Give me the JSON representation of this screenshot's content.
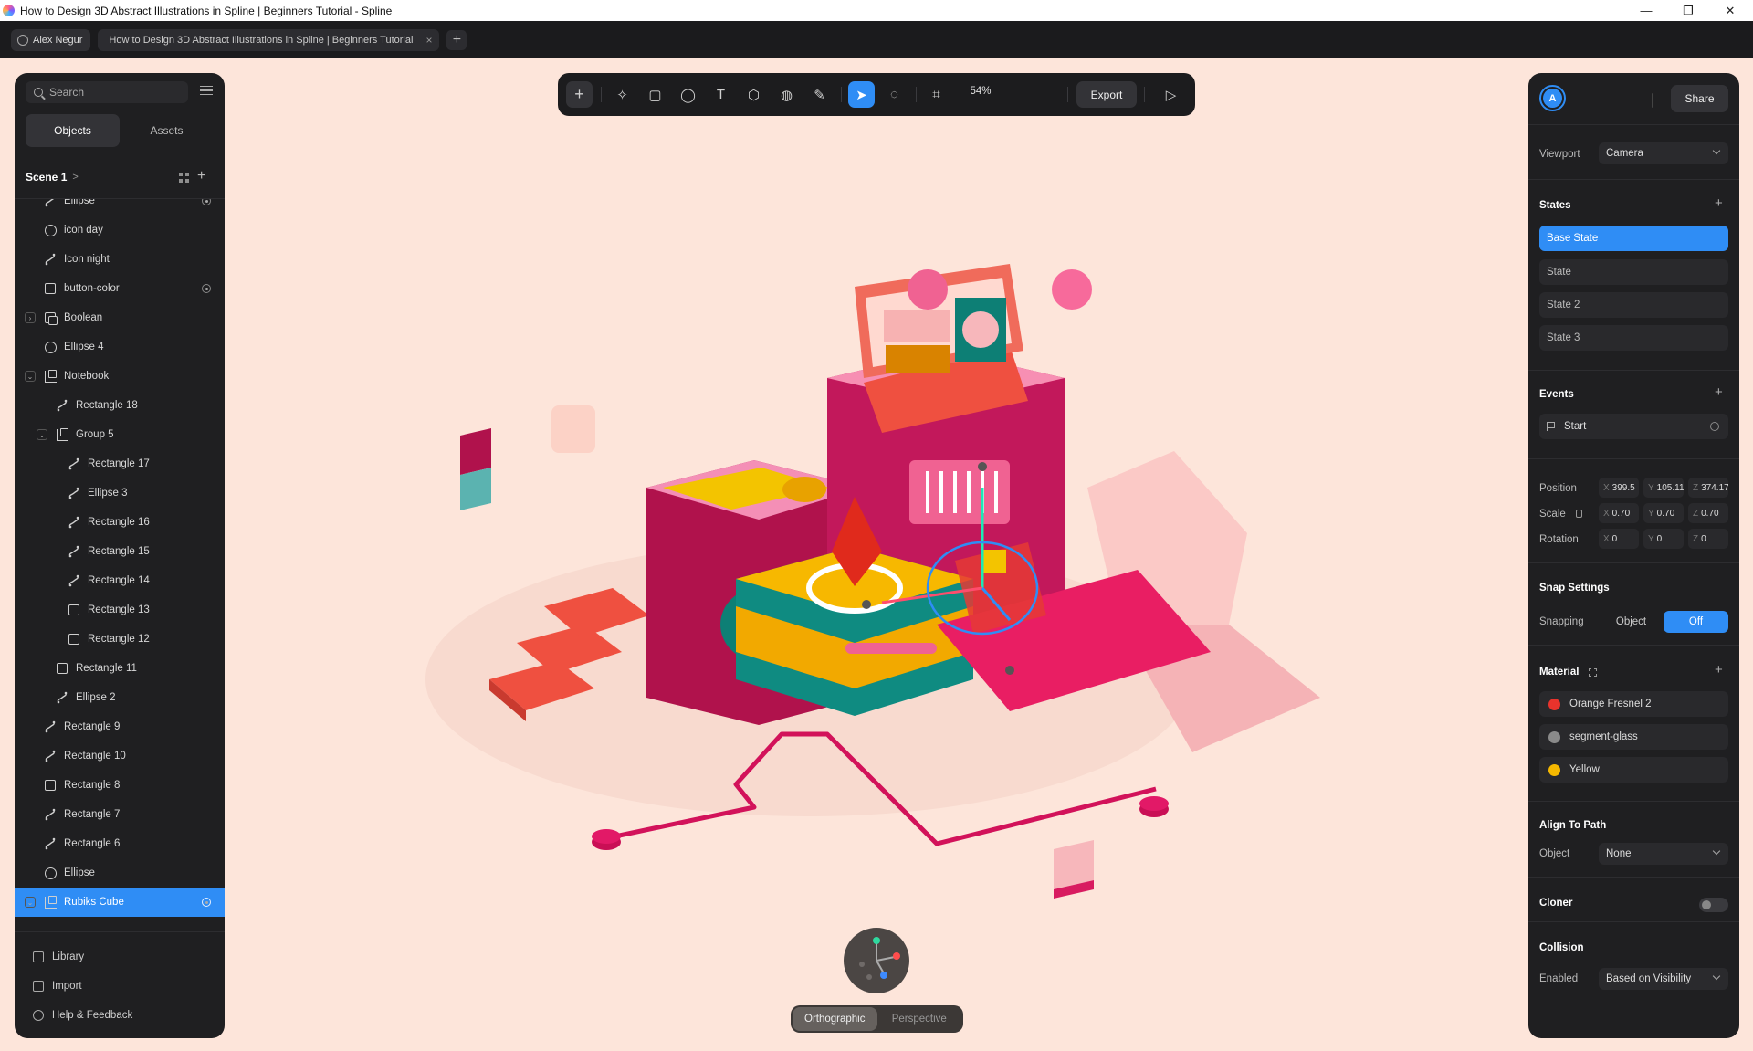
{
  "window": {
    "title": "How to Design 3D Abstract Illustrations in Spline | Beginners Tutorial - Spline",
    "minimize": "—",
    "maximize": "❐",
    "close": "✕"
  },
  "tabbar": {
    "user": "Alex Negur",
    "doc_tab": "How to Design 3D Abstract Illustrations in Spline | Beginners Tutorial",
    "close": "×",
    "add": "+"
  },
  "left_panel": {
    "search_placeholder": "Search",
    "tabs": [
      "Objects",
      "Assets"
    ],
    "scene_name": "Scene 1",
    "scene_chevron": ">",
    "add": "+",
    "tree": [
      {
        "label": "Ellipse",
        "icon": "path-icon",
        "depth": 1,
        "vis": true
      },
      {
        "label": "icon day",
        "icon": "circle-icon",
        "depth": 1,
        "vis": false
      },
      {
        "label": "Icon night",
        "icon": "path-icon",
        "depth": 1,
        "vis": false
      },
      {
        "label": "button-color",
        "icon": "square-icon",
        "depth": 1,
        "vis": true
      },
      {
        "label": "Boolean",
        "icon": "boolean-icon",
        "depth": 1,
        "vis": false,
        "caret": ">"
      },
      {
        "label": "Ellipse 4",
        "icon": "circle-icon",
        "depth": 1,
        "vis": false
      },
      {
        "label": "Notebook",
        "icon": "group-icon",
        "depth": 1,
        "vis": false,
        "caret": "v"
      },
      {
        "label": "Rectangle 18",
        "icon": "path-icon",
        "depth": 2,
        "vis": false
      },
      {
        "label": "Group 5",
        "icon": "group-icon",
        "depth": 2,
        "vis": false,
        "caret": "v"
      },
      {
        "label": "Rectangle 17",
        "icon": "path-icon",
        "depth": 3,
        "vis": false
      },
      {
        "label": "Ellipse 3",
        "icon": "path-icon",
        "depth": 3,
        "vis": false
      },
      {
        "label": "Rectangle 16",
        "icon": "path-icon",
        "depth": 3,
        "vis": false
      },
      {
        "label": "Rectangle 15",
        "icon": "path-icon",
        "depth": 3,
        "vis": false
      },
      {
        "label": "Rectangle 14",
        "icon": "path-icon",
        "depth": 3,
        "vis": false
      },
      {
        "label": "Rectangle 13",
        "icon": "square-icon",
        "depth": 3,
        "vis": false
      },
      {
        "label": "Rectangle 12",
        "icon": "square-icon",
        "depth": 3,
        "vis": false
      },
      {
        "label": "Rectangle 11",
        "icon": "square-icon",
        "depth": 2,
        "vis": false
      },
      {
        "label": "Ellipse 2",
        "icon": "path-icon",
        "depth": 2,
        "vis": false
      },
      {
        "label": "Rectangle 9",
        "icon": "path-icon",
        "depth": 1,
        "vis": false
      },
      {
        "label": "Rectangle 10",
        "icon": "path-icon",
        "depth": 1,
        "vis": false
      },
      {
        "label": "Rectangle 8",
        "icon": "square-icon",
        "depth": 1,
        "vis": false
      },
      {
        "label": "Rectangle 7",
        "icon": "path-icon",
        "depth": 1,
        "vis": false
      },
      {
        "label": "Rectangle 6",
        "icon": "path-icon",
        "depth": 1,
        "vis": false
      },
      {
        "label": "Ellipse",
        "icon": "circle-icon",
        "depth": 1,
        "vis": false
      },
      {
        "label": "Rubiks Cube",
        "icon": "group-icon",
        "depth": 1,
        "vis": true,
        "caret": "v",
        "selected": true
      }
    ],
    "footer": [
      "Library",
      "Import",
      "Help & Feedback"
    ]
  },
  "toolbar": {
    "add": "+",
    "tools": [
      "sparkle-tool-icon",
      "rectangle-tool-icon",
      "ellipse-tool-icon",
      "text-tool-icon",
      "cube-tool-icon",
      "sphere-tool-icon",
      "pen-tool-icon",
      "select-tool-icon",
      "comment-tool-icon",
      "frame-tool-icon"
    ],
    "zoom": "54%",
    "export": "Export",
    "play": "▷"
  },
  "view_toggle": {
    "options": [
      "Orthographic",
      "Perspective"
    ],
    "active": "Orthographic"
  },
  "right_panel": {
    "avatar_letter": "A",
    "share": "Share",
    "viewport_label": "Viewport",
    "viewport_value": "Camera",
    "states_title": "States",
    "states": [
      "Base State",
      "State",
      "State 2",
      "State 3"
    ],
    "events_title": "Events",
    "event_start": "Start",
    "position_label": "Position",
    "position": {
      "x": "399.5",
      "y": "105.11",
      "z": "374.17"
    },
    "scale_label": "Scale",
    "scale": {
      "x": "0.70",
      "y": "0.70",
      "z": "0.70"
    },
    "rotation_label": "Rotation",
    "rotation": {
      "x": "0",
      "y": "0",
      "z": "0"
    },
    "axis": {
      "x": "X",
      "y": "Y",
      "z": "Z"
    },
    "snap_title": "Snap Settings",
    "snapping_label": "Snapping",
    "snap_options": [
      "Object",
      "Off"
    ],
    "material_title": "Material",
    "materials": [
      {
        "name": "Orange Fresnel 2",
        "color": "#e8332c"
      },
      {
        "name": "segment-glass",
        "color": "#8a8a8a"
      },
      {
        "name": "Yellow",
        "color": "#f5b800"
      }
    ],
    "align_title": "Align To Path",
    "align_object_label": "Object",
    "align_object_value": "None",
    "cloner_title": "Cloner",
    "collision_title": "Collision",
    "collision_enabled_label": "Enabled",
    "collision_value": "Based on Visibility"
  },
  "colors": {
    "canvas": "#fde5da",
    "accent": "#2f8df5",
    "panel": "#1f1f21"
  }
}
